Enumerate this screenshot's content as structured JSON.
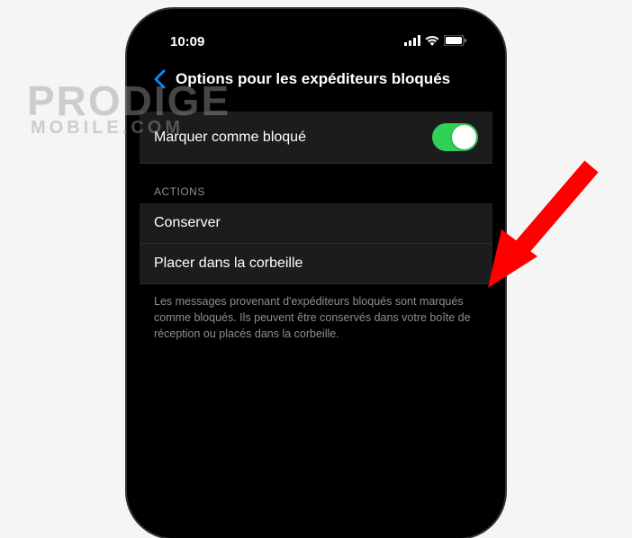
{
  "status_bar": {
    "time": "10:09"
  },
  "nav": {
    "title": "Options pour les expéditeurs bloqués"
  },
  "cells": {
    "mark_blocked": {
      "label": "Marquer comme bloqué",
      "toggle_on": true
    },
    "section_header": "ACTIONS",
    "conserve": {
      "label": "Conserver"
    },
    "trash": {
      "label": "Placer dans la corbeille"
    },
    "footer": "Les messages provenant d'expéditeurs bloqués sont marqués comme bloqués. Ils peuvent être conservés dans votre boîte de réception ou placés dans la corbeille."
  },
  "watermark": {
    "line1": "PRODIGE",
    "line2": "MOBILE.COM"
  },
  "colors": {
    "toggle_green": "#30d158",
    "back_blue": "#0a84ff",
    "arrow_red": "#ff0000"
  }
}
